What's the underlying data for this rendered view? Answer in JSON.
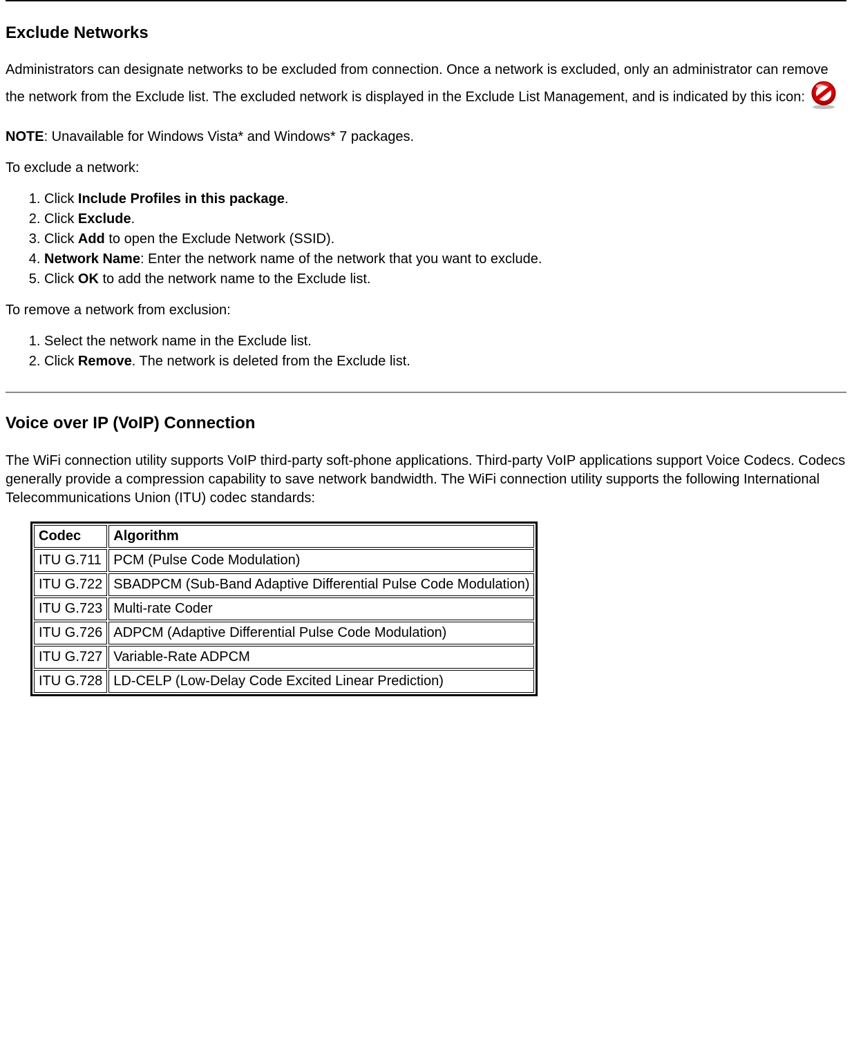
{
  "section1": {
    "heading": "Exclude Networks",
    "intro_before_icon": "Administrators can designate networks to be excluded from connection. Once a network is excluded, only an administrator can remove the network from the Exclude list. The excluded network is displayed in the Exclude List Management, and is indicated by this icon: ",
    "note_label": "NOTE",
    "note_text": ": Unavailable for Windows Vista* and Windows* 7 packages.",
    "exclude_intro": "To exclude a network:",
    "exclude_steps": [
      {
        "prefix": "Click ",
        "bold": "Include Profiles in this package",
        "suffix": "."
      },
      {
        "prefix": "Click ",
        "bold": "Exclude",
        "suffix": "."
      },
      {
        "prefix": "Click ",
        "bold": "Add",
        "suffix": " to open the Exclude Network (SSID)."
      },
      {
        "prefix": "",
        "bold": "Network Name",
        "suffix": ": Enter the network name of the network that you want to exclude."
      },
      {
        "prefix": "Click ",
        "bold": "OK",
        "suffix": " to add the network name to the Exclude list."
      }
    ],
    "remove_intro": "To remove a network from exclusion:",
    "remove_steps": [
      {
        "prefix": "Select the network name in the Exclude list.",
        "bold": "",
        "suffix": ""
      },
      {
        "prefix": "Click ",
        "bold": "Remove",
        "suffix": ". The network is deleted from the Exclude list."
      }
    ]
  },
  "section2": {
    "heading": "Voice over IP (VoIP) Connection",
    "intro": "The WiFi connection utility supports VoIP third-party soft-phone applications. Third-party VoIP applications support Voice Codecs. Codecs generally provide a compression capability to save network bandwidth. The WiFi connection utility supports the following International Telecommunications Union (ITU) codec standards:",
    "table": {
      "headers": [
        "Codec",
        "Algorithm"
      ],
      "rows": [
        [
          "ITU G.711",
          "PCM (Pulse Code Modulation)"
        ],
        [
          "ITU G.722",
          "SBADPCM (Sub-Band Adaptive Differential Pulse Code Modulation)"
        ],
        [
          "ITU G.723",
          "Multi-rate Coder"
        ],
        [
          "ITU G.726",
          "ADPCM (Adaptive Differential Pulse Code Modulation)"
        ],
        [
          "ITU G.727",
          "Variable-Rate ADPCM"
        ],
        [
          "ITU G.728",
          "LD-CELP (Low-Delay Code Excited Linear Prediction)"
        ]
      ]
    }
  }
}
